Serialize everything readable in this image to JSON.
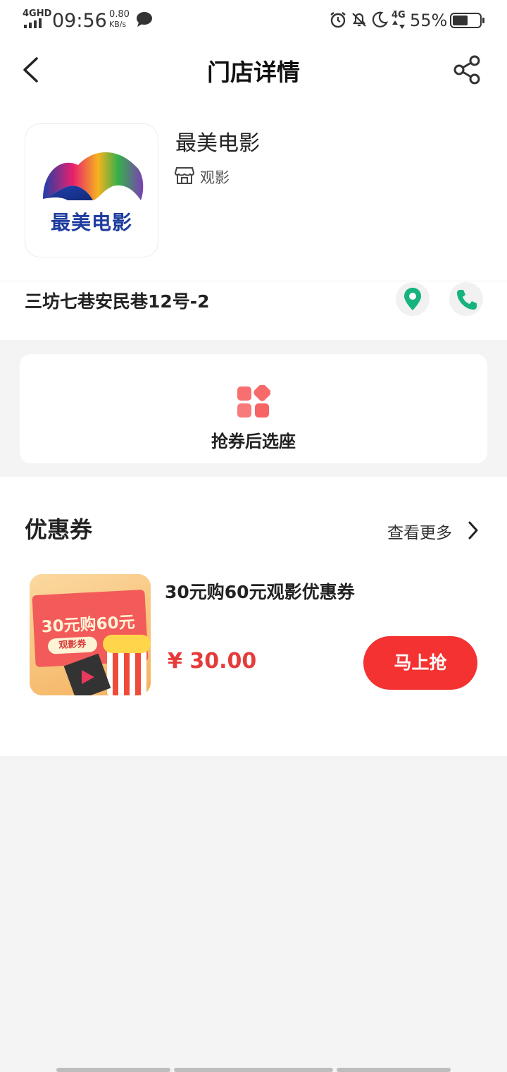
{
  "status_bar": {
    "network": "4GHD",
    "time": "09:56",
    "speed_value": "0.80",
    "speed_unit": "KB/s",
    "network2": "4G",
    "battery": "55%"
  },
  "header": {
    "title": "门店详情"
  },
  "store": {
    "name": "最美电影",
    "logo_text": "最美电影",
    "category": "观影",
    "address": "三坊七巷安民巷12号-2"
  },
  "seat_entry": {
    "label": "抢券后选座"
  },
  "coupons": {
    "title": "优惠券",
    "more_label": "查看更多",
    "items": [
      {
        "title": "30元购60元观影优惠券",
        "price": "¥ 30.00",
        "button": "马上抢",
        "thumb_text": "30元购60元",
        "thumb_sub": "观影券"
      }
    ]
  },
  "colors": {
    "accent_red": "#f43232",
    "price_red": "#e63b3b",
    "green": "#17b37e"
  }
}
